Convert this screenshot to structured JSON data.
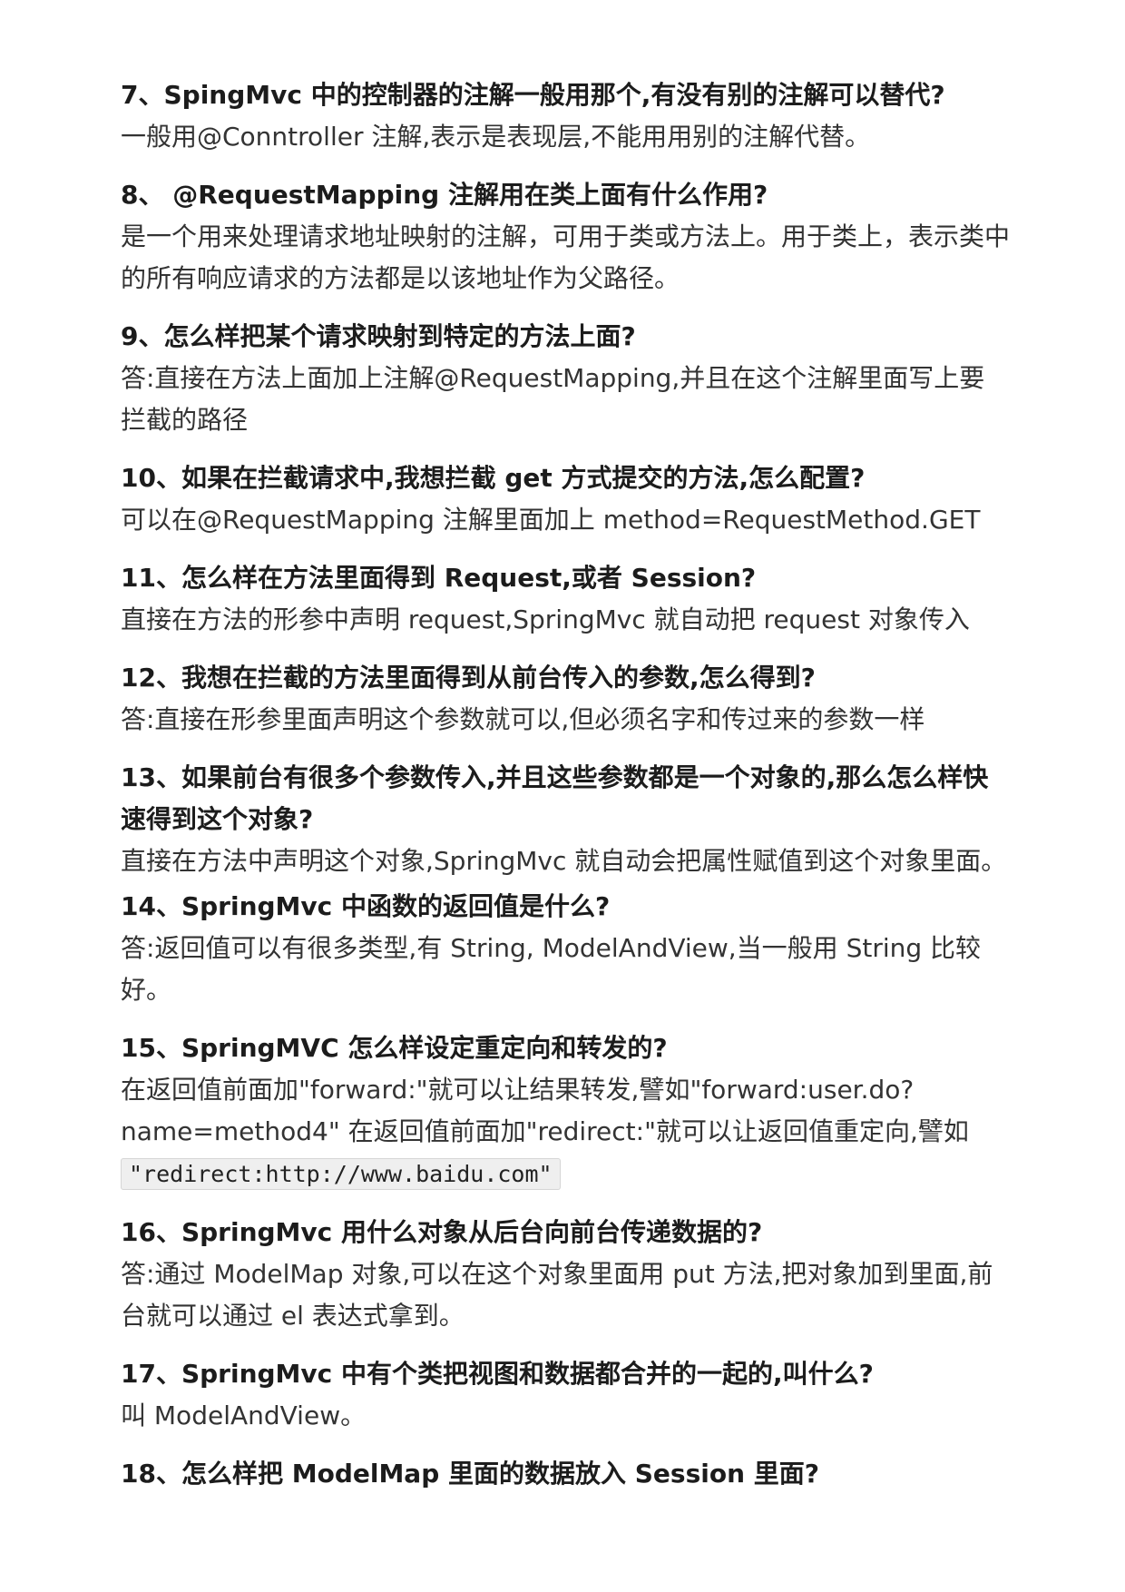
{
  "items": [
    {
      "q": "7、SpingMvc 中的控制器的注解一般用那个,有没有别的注解可以替代?",
      "a": "一般用@Conntroller 注解,表示是表现层,不能用用别的注解代替。"
    },
    {
      "q": "8、 @RequestMapping 注解用在类上面有什么作用?",
      "a": "是一个用来处理请求地址映射的注解，可用于类或方法上。用于类上，表示类中的所有响应请求的方法都是以该地址作为父路径。"
    },
    {
      "q": "9、怎么样把某个请求映射到特定的方法上面?",
      "a": "答:直接在方法上面加上注解@RequestMapping,并且在这个注解里面写上要拦截的路径"
    },
    {
      "q": "10、如果在拦截请求中,我想拦截 get 方式提交的方法,怎么配置?",
      "a": "可以在@RequestMapping 注解里面加上 method=RequestMethod.GET"
    },
    {
      "q": "11、怎么样在方法里面得到 Request,或者 Session?",
      "a": "直接在方法的形参中声明 request,SpringMvc 就自动把 request 对象传入"
    },
    {
      "q": "12、我想在拦截的方法里面得到从前台传入的参数,怎么得到?",
      "a": "答:直接在形参里面声明这个参数就可以,但必须名字和传过来的参数一样"
    },
    {
      "q": "13、如果前台有很多个参数传入,并且这些参数都是一个对象的,那么怎么样快速得到这个对象?",
      "a": "直接在方法中声明这个对象,SpringMvc 就自动会把属性赋值到这个对象里面。"
    },
    {
      "q": "14、SpringMvc 中函数的返回值是什么?",
      "a": "答:返回值可以有很多类型,有 String, ModelAndView,当一般用 String 比较好。"
    },
    {
      "q": "15、SpringMVC 怎么样设定重定向和转发的?",
      "a": "在返回值前面加\"forward:\"就可以让结果转发,譬如\"forward:user.do?name=method4\" 在返回值前面加\"redirect:\"就可以让返回值重定向,譬如",
      "code": "\"redirect:http://www.baidu.com\""
    },
    {
      "q": "16、SpringMvc 用什么对象从后台向前台传递数据的?",
      "a": "答:通过 ModelMap 对象,可以在这个对象里面用 put 方法,把对象加到里面,前台就可以通过 el 表达式拿到。"
    },
    {
      "q": "17、SpringMvc 中有个类把视图和数据都合并的一起的,叫什么?",
      "a": "叫 ModelAndView。"
    },
    {
      "q": "18、怎么样把 ModelMap 里面的数据放入 Session 里面?"
    }
  ]
}
